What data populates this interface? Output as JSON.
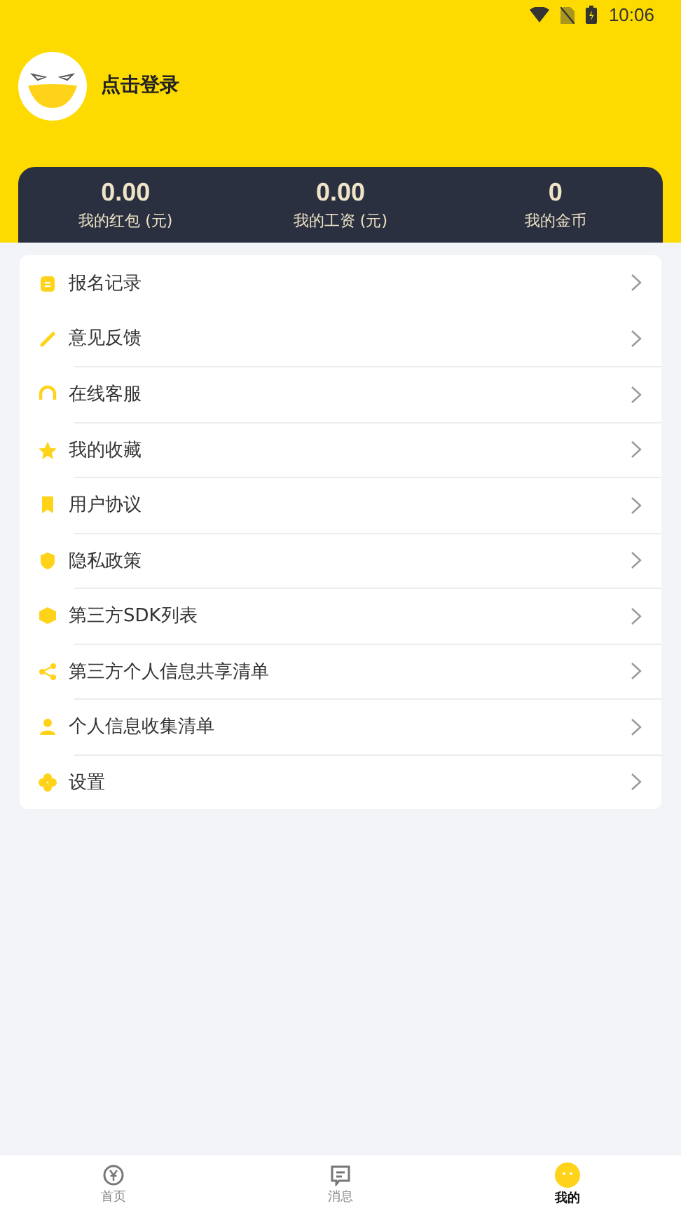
{
  "status_bar": {
    "time": "10:06"
  },
  "profile": {
    "login_text": "点击登录"
  },
  "stats": [
    {
      "value": "0.00",
      "label": "我的红包 (元)"
    },
    {
      "value": "0.00",
      "label": "我的工资 (元)"
    },
    {
      "value": "0",
      "label": "我的金币"
    }
  ],
  "menu": [
    {
      "label": "报名记录"
    },
    {
      "label": "意见反馈"
    },
    {
      "label": "在线客服"
    },
    {
      "label": "我的收藏"
    },
    {
      "label": "用户协议"
    },
    {
      "label": "隐私政策"
    },
    {
      "label": "第三方SDK列表"
    },
    {
      "label": "第三方个人信息共享清单"
    },
    {
      "label": "个人信息收集清单"
    },
    {
      "label": "设置"
    }
  ],
  "tabs": [
    {
      "label": "首页",
      "selected": false
    },
    {
      "label": "消息",
      "selected": false
    },
    {
      "label": "我的",
      "selected": true
    }
  ]
}
